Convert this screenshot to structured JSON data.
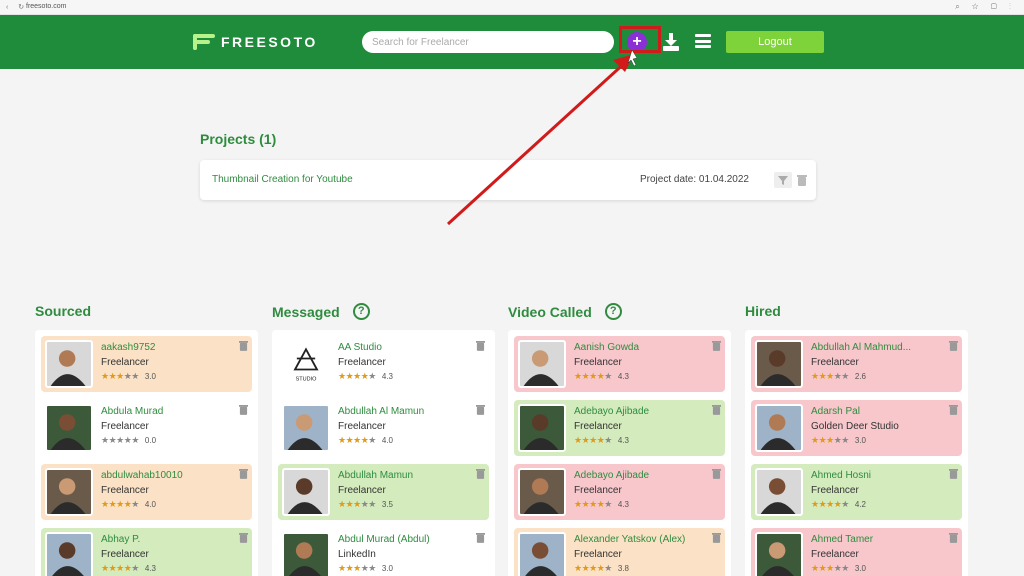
{
  "browser": {
    "url": "freesoto.com"
  },
  "header": {
    "logo_text": "FREESOTO",
    "search_placeholder": "Search for Freelancer",
    "logout_label": "Logout",
    "add_icon": "plus-circle-icon",
    "download_icon": "download-icon",
    "menu_icon": "hamburger-menu-icon"
  },
  "projects": {
    "title": "Projects (1)",
    "items": [
      {
        "name": "Thumbnail Creation for Youtube",
        "date": "Project date: 01.04.2022"
      }
    ]
  },
  "colors": {
    "brand": "#1f8c3b",
    "accent_green": "#7fd33a",
    "text_green": "#2f8c3f",
    "add_purple": "#8b2fd6",
    "annotation_red": "#d11a1a",
    "card_orange": "#fbe2c6",
    "card_green": "#d3ebbd",
    "card_pink": "#f7c7cc",
    "star": "#e09a17"
  },
  "columns": [
    {
      "title": "Sourced",
      "help": false,
      "cards": [
        {
          "name": "aakash9752",
          "role": "Freelancer",
          "rating": "3.0",
          "stars": 3,
          "color": "orange"
        },
        {
          "name": "Abdula Murad",
          "role": "Freelancer",
          "rating": "0.0",
          "stars": 0,
          "color": "white"
        },
        {
          "name": "abdulwahab10010",
          "role": "Freelancer",
          "rating": "4.0",
          "stars": 4,
          "color": "orange"
        },
        {
          "name": "Abhay P.",
          "role": "Freelancer",
          "rating": "4.3",
          "stars": 4,
          "color": "green"
        }
      ]
    },
    {
      "title": "Messaged",
      "help": true,
      "cards": [
        {
          "name": "AA Studio",
          "role": "Freelancer",
          "rating": "4.3",
          "stars": 4,
          "color": "white",
          "logo": "STUDIO"
        },
        {
          "name": "Abdullah Al Mamun",
          "role": "Freelancer",
          "rating": "4.0",
          "stars": 4,
          "color": "white"
        },
        {
          "name": "Abdullah Mamun",
          "role": "Freelancer",
          "rating": "3.5",
          "stars": 3,
          "color": "green"
        },
        {
          "name": "Abdul Murad (Abdul)",
          "role": "LinkedIn",
          "rating": "3.0",
          "stars": 3,
          "color": "white"
        }
      ]
    },
    {
      "title": "Video Called",
      "help": true,
      "cards": [
        {
          "name": "Aanish Gowda",
          "role": "Freelancer",
          "rating": "4.3",
          "stars": 4,
          "color": "pink"
        },
        {
          "name": "Adebayo Ajibade",
          "role": "Freelancer",
          "rating": "4.3",
          "stars": 4,
          "color": "green"
        },
        {
          "name": "Adebayo Ajibade",
          "role": "Freelancer",
          "rating": "4.3",
          "stars": 4,
          "color": "pink"
        },
        {
          "name": "Alexander Yatskov (Alex)",
          "role": "Freelancer",
          "rating": "3.8",
          "stars": 4,
          "color": "orange"
        }
      ]
    },
    {
      "title": "Hired",
      "help": false,
      "cards": [
        {
          "name": "Abdullah Al Mahmud...",
          "role": "Freelancer",
          "rating": "2.6",
          "stars": 3,
          "color": "pink"
        },
        {
          "name": "Adarsh Pal",
          "role": "Golden Deer Studio",
          "rating": "3.0",
          "stars": 3,
          "color": "pink"
        },
        {
          "name": "Ahmed Hosni",
          "role": "Freelancer",
          "rating": "4.2",
          "stars": 4,
          "color": "green"
        },
        {
          "name": "Ahmed Tamer",
          "role": "Freelancer",
          "rating": "3.0",
          "stars": 3,
          "color": "pink"
        }
      ]
    }
  ]
}
